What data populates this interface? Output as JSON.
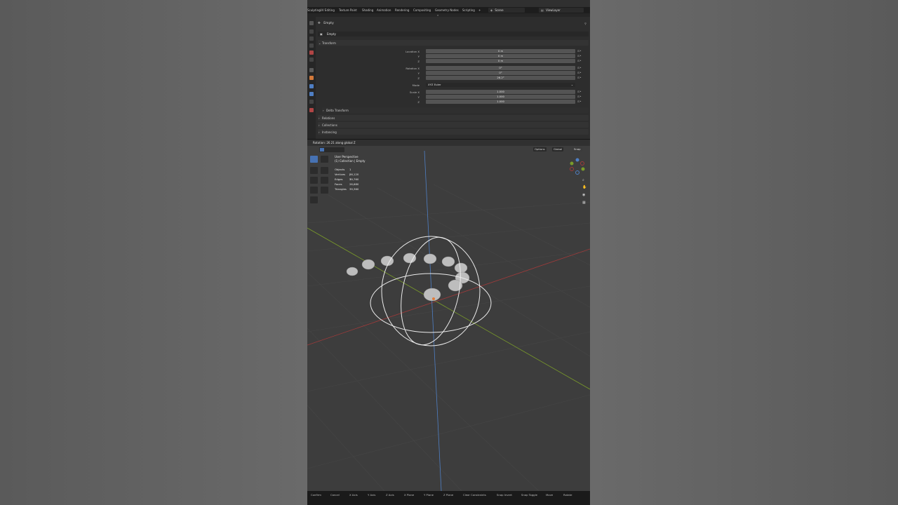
{
  "topbar": {
    "tabs": [
      "Sculpting",
      "UV Editing",
      "Texture Paint",
      "Shading",
      "Animation",
      "Rendering",
      "Compositing",
      "Geometry Nodes",
      "Scripting",
      "+"
    ],
    "scene": "Scene",
    "view_layer": "ViewLayer"
  },
  "properties": {
    "object_name": "Empty",
    "data_name": "Empty",
    "transform_label": "Transform",
    "location": {
      "label_x": "Location X",
      "label_y": "Y",
      "label_z": "Z",
      "x": "0 m",
      "y": "0 m",
      "z": "0 m"
    },
    "rotation": {
      "label_x": "Rotation X",
      "label_y": "Y",
      "label_z": "Z",
      "x": "0°",
      "y": "0°",
      "z": "26.2°"
    },
    "mode": {
      "label": "Mode",
      "value": "XYZ Euler"
    },
    "scale": {
      "label_x": "Scale X",
      "label_y": "Y",
      "label_z": "Z",
      "x": "1.000",
      "y": "1.000",
      "z": "1.000"
    },
    "panels": [
      "Delta Transform",
      "Relations",
      "Collections",
      "Instancing"
    ]
  },
  "viewport": {
    "status": "Rotation: 26.21 along global Z",
    "options": "Options",
    "global": "Global",
    "snap": "Snap",
    "perspective": "User Perspective",
    "collection": "(1) Collection | Empty",
    "stats": [
      {
        "k": "Objects",
        "v": "1 / 3"
      },
      {
        "k": "Vertices",
        "v": "26,120"
      },
      {
        "k": "Edges",
        "v": "39,760"
      },
      {
        "k": "Faces",
        "v": "26,680"
      },
      {
        "k": "Triangles",
        "v": "39,360"
      }
    ]
  },
  "bottombar": {
    "hints": [
      "Confirm",
      "Cancel",
      "X Axis",
      "Y Axis",
      "Z Axis",
      "X Plane",
      "Y Plane",
      "Z Plane",
      "Clear Constraints",
      "Snap Invert",
      "Snap Toggle",
      "Move",
      "Rotate"
    ]
  },
  "colors": {
    "accent": "#4772b3",
    "x_axis": "#a03a3a",
    "y_axis": "#7a9b2a",
    "z_axis": "#4f7fc4"
  }
}
